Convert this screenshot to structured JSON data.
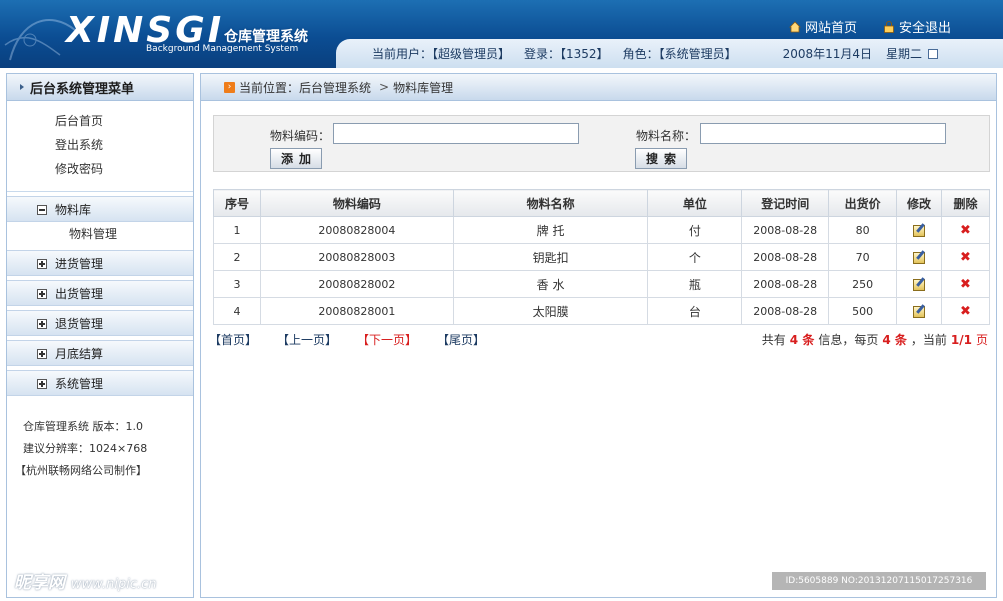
{
  "header": {
    "logo_main": "XINSGI",
    "logo_cn": "仓库管理系统",
    "logo_en": "Background Management System",
    "home_link": "网站首页",
    "logout_link": "安全退出",
    "current_user": "当前用户：【超级管理员】",
    "login_count": "登录：【1352】",
    "role": "角色：【系统管理员】",
    "date": "2008年11月4日",
    "weekday": "星期二"
  },
  "sidebar": {
    "title": "后台系统管理菜单",
    "quick_links": [
      "后台首页",
      "登出系统",
      "修改密码"
    ],
    "menus": [
      {
        "label": "物料库",
        "expanded": true,
        "children": [
          "物料管理"
        ]
      },
      {
        "label": "进货管理",
        "expanded": false
      },
      {
        "label": "出货管理",
        "expanded": false
      },
      {
        "label": "退货管理",
        "expanded": false
      },
      {
        "label": "月底结算",
        "expanded": false
      },
      {
        "label": "系统管理",
        "expanded": false
      }
    ],
    "info_line1": "仓库管理系统  版本：1.0",
    "info_line2": "建议分辨率：1024×768",
    "info_line3": "【杭州联畅网络公司制作】"
  },
  "main": {
    "breadcrumb_prefix": "当前位置：后台管理系统",
    "breadcrumb_current": "物料库管理",
    "search": {
      "code_label": "物料编码：",
      "code_value": "",
      "name_label": "物料名称：",
      "name_value": "",
      "add_button": "添加",
      "search_button": "搜索"
    },
    "table": {
      "headers": [
        "序号",
        "物料编码",
        "物料名称",
        "单位",
        "登记时间",
        "出货价",
        "修改",
        "删除"
      ],
      "rows": [
        {
          "no": "1",
          "code": "20080828004",
          "name": "牌 托",
          "unit": "付",
          "date": "2008-08-28",
          "price": "80"
        },
        {
          "no": "2",
          "code": "20080828003",
          "name": "钥匙扣",
          "unit": "个",
          "date": "2008-08-28",
          "price": "70"
        },
        {
          "no": "3",
          "code": "20080828002",
          "name": "香 水",
          "unit": "瓶",
          "date": "2008-08-28",
          "price": "250"
        },
        {
          "no": "4",
          "code": "20080828001",
          "name": "太阳膜",
          "unit": "台",
          "date": "2008-08-28",
          "price": "500"
        }
      ]
    },
    "pager": {
      "first": "【首页】",
      "prev": "【上一页】",
      "next": "【下一页】",
      "last": "【尾页】",
      "total_prefix": "共有",
      "total": "4 条",
      "per_page_prefix": "信息，每页",
      "per_page": "4 条",
      "current_prefix": "，当前",
      "current": "1/1",
      "page_suffix": "页"
    }
  },
  "watermark": {
    "left": "昵享网",
    "left_url": "www.nipic.cn",
    "right": "ID:5605889 NO:20131207115017257316"
  },
  "colors": {
    "header_blue": "#0b4d93",
    "accent_red": "#d81e1e",
    "border": "#a9c2de"
  }
}
